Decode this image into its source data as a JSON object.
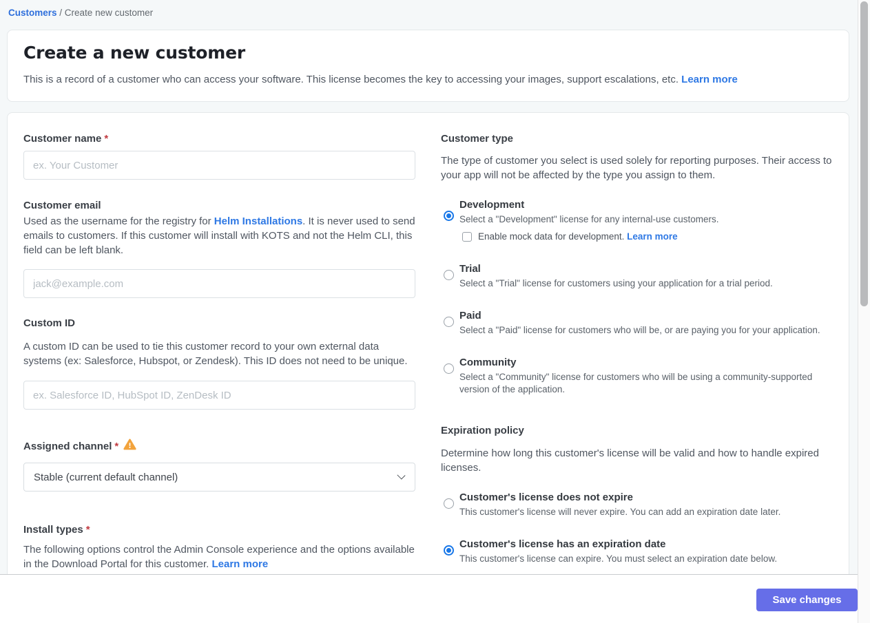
{
  "breadcrumb": {
    "link": "Customers",
    "separator": " / ",
    "current": "Create new customer"
  },
  "header": {
    "title": "Create a new customer",
    "description": "This is a record of a customer who can access your software. This license becomes the key to accessing your images, support escalations, etc. ",
    "learn_more": "Learn more"
  },
  "form": {
    "customer_name": {
      "label": "Customer name",
      "required": "*",
      "placeholder": "ex. Your Customer"
    },
    "customer_email": {
      "label": "Customer email",
      "description_before": "Used as the username for the registry for ",
      "link": "Helm Installations",
      "description_after": ". It is never used to send emails to customers. If this customer will install with KOTS and not the Helm CLI, this field can be left blank.",
      "placeholder": "jack@example.com"
    },
    "custom_id": {
      "label": "Custom ID",
      "description": "A custom ID can be used to tie this customer record to your own external data systems (ex: Salesforce, Hubspot, or Zendesk). This ID does not need to be unique.",
      "placeholder": "ex. Salesforce ID, HubSpot ID, ZenDesk ID"
    },
    "assigned_channel": {
      "label": "Assigned channel",
      "required": "*",
      "selected_value": "Stable (current default channel)"
    },
    "install_types": {
      "label": "Install types",
      "required": "*",
      "description": "The following options control the Admin Console experience and the options available in the Download Portal for this customer. ",
      "learn_more": "Learn more"
    }
  },
  "customer_type": {
    "label": "Customer type",
    "description": "The type of customer you select is used solely for reporting purposes. Their access to your app will not be affected by the type you assign to them.",
    "options": [
      {
        "label": "Development",
        "description": "Select a \"Development\" license for any internal-use customers.",
        "selected": true,
        "checkbox_label": "Enable mock data for development. ",
        "checkbox_link": "Learn more",
        "checkbox_checked": false
      },
      {
        "label": "Trial",
        "description": "Select a \"Trial\" license for customers using your application for a trial period.",
        "selected": false
      },
      {
        "label": "Paid",
        "description": "Select a \"Paid\" license for customers who will be, or are paying you for your application.",
        "selected": false
      },
      {
        "label": "Community",
        "description": "Select a \"Community\" license for customers who will be using a community-supported version of the application.",
        "selected": false
      }
    ]
  },
  "expiration_policy": {
    "label": "Expiration policy",
    "description": "Determine how long this customer's license will be valid and how to handle expired licenses.",
    "options": [
      {
        "label": "Customer's license does not expire",
        "description": "This customer's license will never expire. You can add an expiration date later.",
        "selected": false
      },
      {
        "label": "Customer's license has an expiration date",
        "description": "This customer's license can expire. You must select an expiration date below.",
        "selected": true
      }
    ]
  },
  "footer": {
    "save_button": "Save changes"
  },
  "colors": {
    "link_blue": "#2e78e4",
    "radio_selected_blue": "#1877e8",
    "save_button_indigo": "#666ee8",
    "required_red": "#c13a40",
    "warning_amber": "#f2a33c",
    "page_background": "#f5f8f9"
  }
}
